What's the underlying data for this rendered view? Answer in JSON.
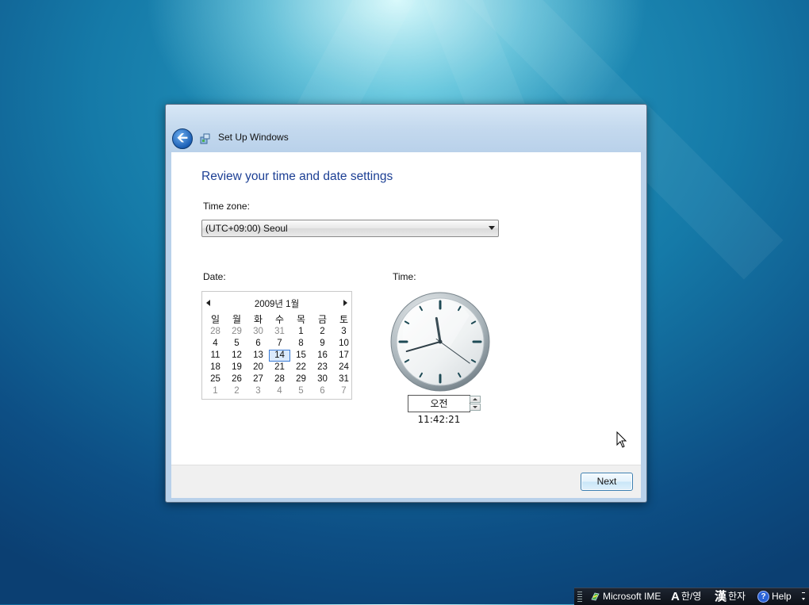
{
  "window": {
    "title": "Set Up Windows",
    "back_symbol": "🡨"
  },
  "main": {
    "heading": "Review your time and date settings",
    "timezone_label": "Time zone:",
    "timezone_value": "(UTC+09:00) Seoul",
    "date_label": "Date:",
    "time_label": "Time:"
  },
  "calendar": {
    "title": "2009년 1월",
    "weekdays": [
      "일",
      "월",
      "화",
      "수",
      "목",
      "금",
      "토"
    ],
    "weeks": [
      [
        {
          "d": "28",
          "o": true
        },
        {
          "d": "29",
          "o": true
        },
        {
          "d": "30",
          "o": true
        },
        {
          "d": "31",
          "o": true
        },
        {
          "d": "1"
        },
        {
          "d": "2"
        },
        {
          "d": "3"
        }
      ],
      [
        {
          "d": "4"
        },
        {
          "d": "5"
        },
        {
          "d": "6"
        },
        {
          "d": "7"
        },
        {
          "d": "8"
        },
        {
          "d": "9"
        },
        {
          "d": "10"
        }
      ],
      [
        {
          "d": "11"
        },
        {
          "d": "12"
        },
        {
          "d": "13"
        },
        {
          "d": "14",
          "t": true
        },
        {
          "d": "15"
        },
        {
          "d": "16"
        },
        {
          "d": "17"
        }
      ],
      [
        {
          "d": "18"
        },
        {
          "d": "19"
        },
        {
          "d": "20"
        },
        {
          "d": "21"
        },
        {
          "d": "22"
        },
        {
          "d": "23"
        },
        {
          "d": "24"
        }
      ],
      [
        {
          "d": "25"
        },
        {
          "d": "26"
        },
        {
          "d": "27"
        },
        {
          "d": "28"
        },
        {
          "d": "29"
        },
        {
          "d": "30"
        },
        {
          "d": "31"
        }
      ],
      [
        {
          "d": "1",
          "o": true
        },
        {
          "d": "2",
          "o": true
        },
        {
          "d": "3",
          "o": true
        },
        {
          "d": "4",
          "o": true
        },
        {
          "d": "5",
          "o": true
        },
        {
          "d": "6",
          "o": true
        },
        {
          "d": "7",
          "o": true
        }
      ]
    ]
  },
  "time": {
    "value": "오전 11:42:21",
    "hour": 11,
    "minute": 42,
    "second": 21
  },
  "footer": {
    "next_label": "Next"
  },
  "langbar": {
    "ime_label": "Microsoft IME",
    "mode_label": "한/영",
    "hanja_label": "한자",
    "help_label": "Help",
    "mode_glyph": "A",
    "hanja_glyph": "漢",
    "help_glyph": "?"
  },
  "colors": {
    "heading": "#1c3f94",
    "accent": "#3a7bd5"
  }
}
